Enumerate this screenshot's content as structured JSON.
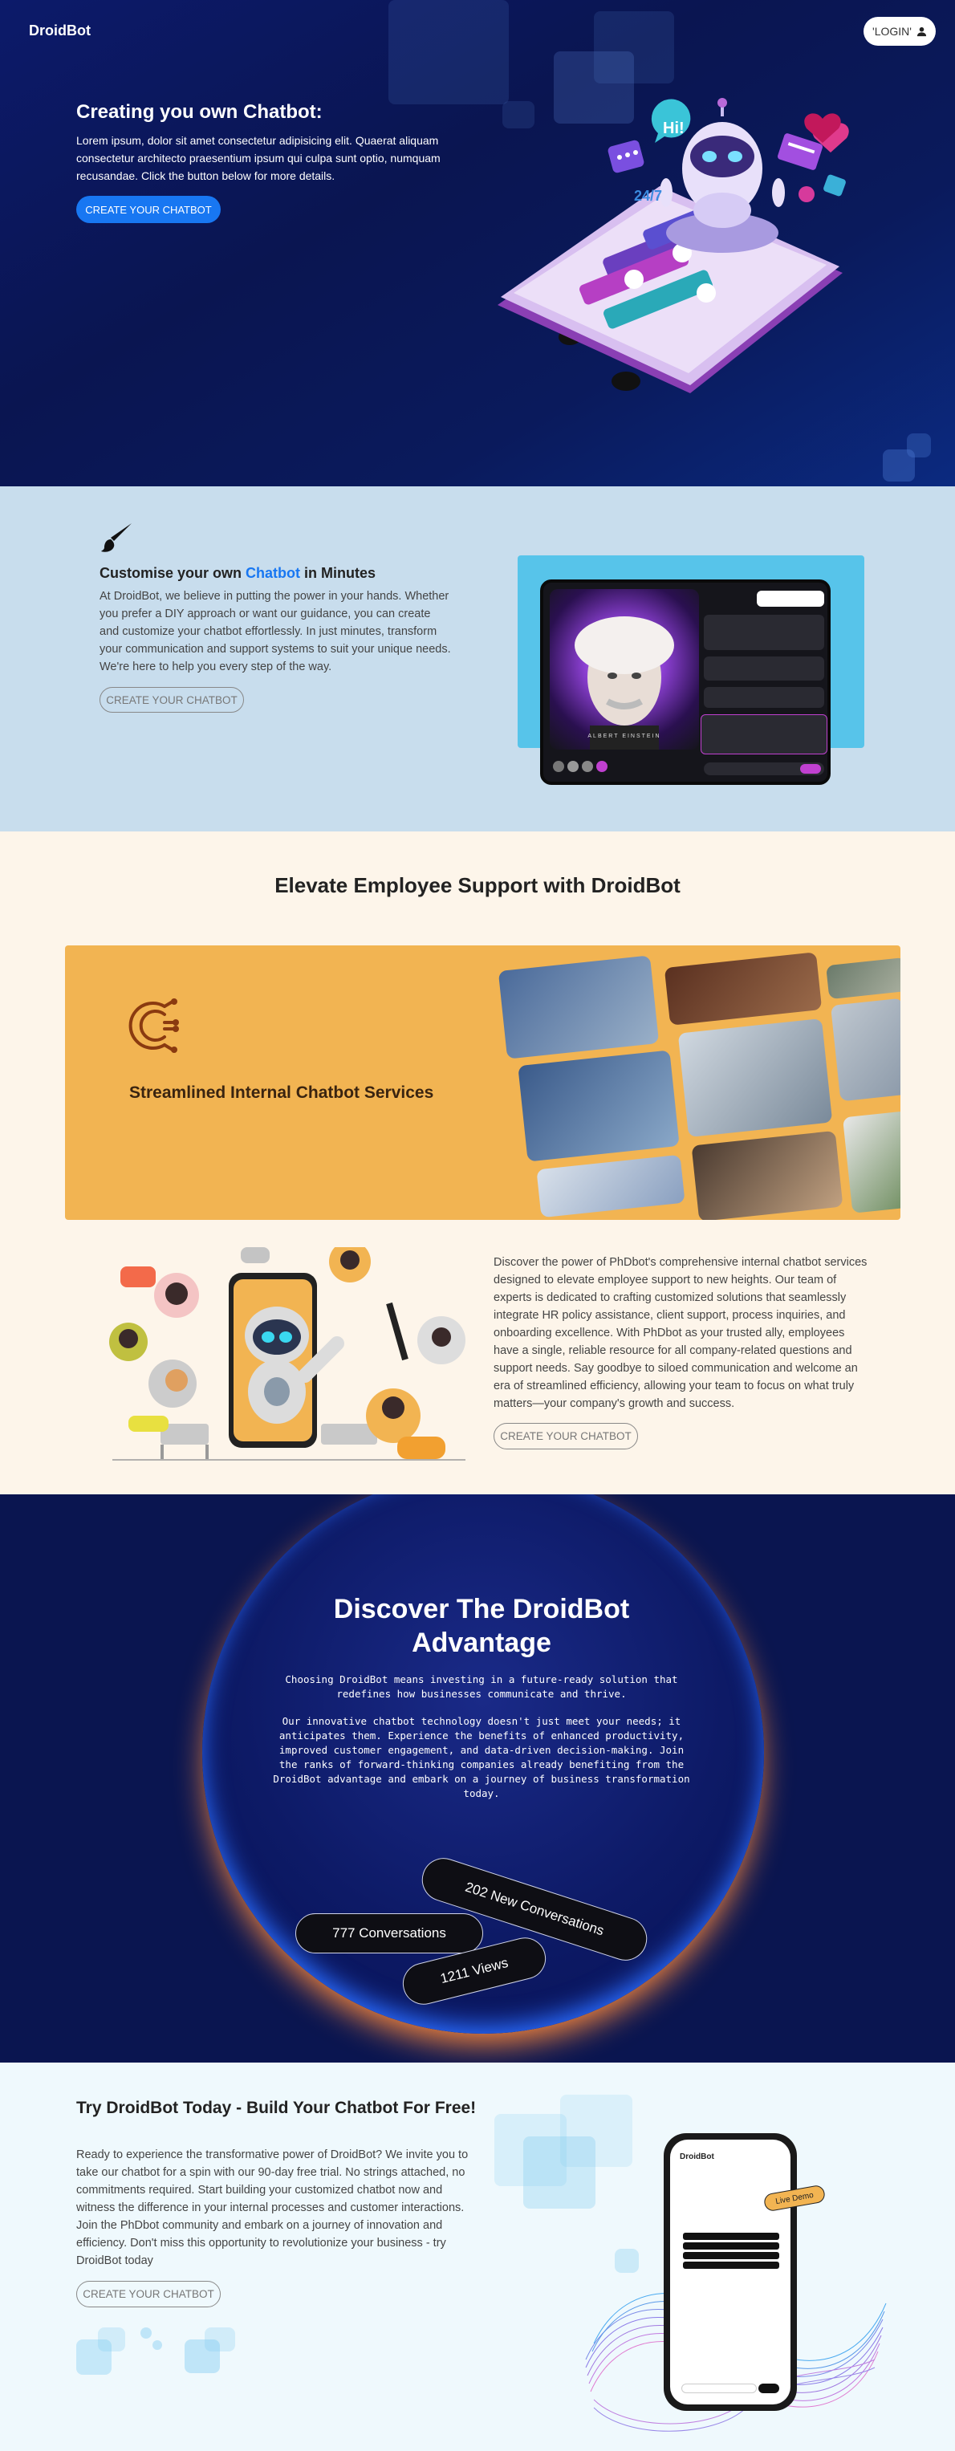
{
  "header": {
    "brand": "DroidBot",
    "login_label": "LOGIN"
  },
  "hero": {
    "title": "Creating you own Chatbot:",
    "text": "Lorem ipsum, dolor sit amet consectetur adipisicing elit. Quaerat aliquam consectetur architecto praesentium ipsum qui culpa sunt optio, numquam recusandae. Click the button below for more details.",
    "button": "CREATE YOUR CHATBOT",
    "bubble_hi": "Hi!",
    "bubble_247": "24/7"
  },
  "customise": {
    "title_pre": "Customise your own ",
    "title_highlight": "Chatbot",
    "title_post": " in Minutes",
    "text": "At DroidBot, we believe in putting the power in your hands. Whether you prefer a DIY approach or want our guidance, you can create and customize your chatbot effortlessly. In just minutes, transform your communication and support systems to suit your unique needs. We're here to help you every step of the way.",
    "button": "CREATE YOUR CHATBOT",
    "tablet_name": "ALBERT EINSTEIN"
  },
  "elevate": {
    "title": "Elevate Employee Support with DroidBot",
    "box_title": "Streamlined Internal Chatbot Services",
    "text": "Discover the power of PhDbot's comprehensive internal chatbot services designed to elevate employee support to new heights. Our team of experts is dedicated to crafting customized solutions that seamlessly integrate HR policy assistance, client support, process inquiries, and onboarding excellence. With PhDbot as your trusted ally, employees have a single, reliable resource for all company-related questions and support needs. Say goodbye to siloed communication and welcome an era of streamlined efficiency, allowing your team to focus on what truly matters—your company's growth and success.",
    "button": "CREATE YOUR CHATBOT"
  },
  "discover": {
    "title": "Discover The DroidBot Advantage",
    "text1": "Choosing DroidBot means investing in a future-ready solution that redefines how businesses communicate and thrive.",
    "text2": "Our innovative chatbot technology doesn't just meet your needs; it anticipates them. Experience the benefits of enhanced productivity, improved customer engagement, and data-driven decision-making. Join the ranks of forward-thinking companies already benefiting from the DroidBot advantage and embark on a journey of business transformation today.",
    "stat_new": "202 New Conversations",
    "stat_conv": "777 Conversations",
    "stat_views": "1211 Views"
  },
  "try": {
    "title": "Try DroidBot Today - Build Your Chatbot For Free!",
    "text": "Ready to experience the transformative power of DroidBot? We invite you to take our chatbot for a spin with our 90-day free trial. No strings attached, no commitments required. Start building your customized chatbot now and witness the difference in your internal processes and customer interactions. Join the PhDbot community and embark on a journey of innovation and efficiency. Don't miss this opportunity to revolutionize your business - try DroidBot today",
    "button": "CREATE YOUR CHATBOT",
    "phone_brand": "DroidBot",
    "live_demo": "Live Demo"
  },
  "colors": {
    "hero_bg": "#0a1551",
    "accent": "#1877f2",
    "customise_bg": "#c8dded",
    "elevate_bg": "#fdf5ea",
    "orange": "#f2b452",
    "discover_bg": "#0a1550",
    "try_bg": "#eff9fd"
  }
}
